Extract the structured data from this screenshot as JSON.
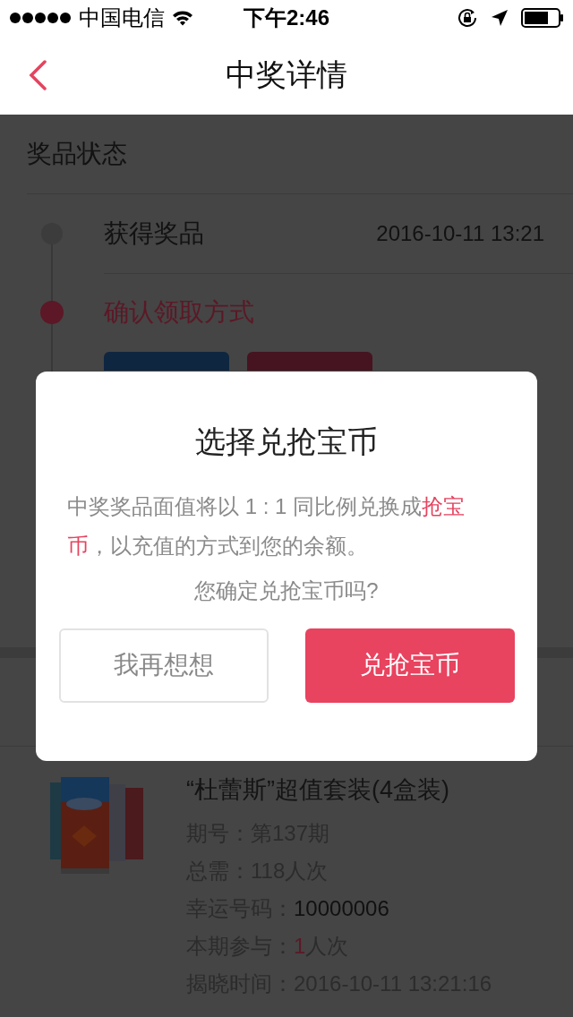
{
  "status_bar": {
    "carrier": "中国电信",
    "time": "下午2:46"
  },
  "nav": {
    "title": "中奖详情"
  },
  "prize_status": {
    "title": "奖品状态",
    "steps": [
      {
        "label": "获得奖品",
        "time": "2016-10-11 13:21",
        "active": false
      },
      {
        "label": "确认领取方式",
        "active": true
      }
    ],
    "claim_buttons": [
      {
        "color": "#0e2640"
      },
      {
        "color": "#461420"
      }
    ]
  },
  "product": {
    "title": "“杜蕾斯”超值套装(4盒装)",
    "lines": [
      {
        "label": "期号：",
        "parts": [
          {
            "text": "第137期",
            "kind": "normal"
          }
        ]
      },
      {
        "label": "总需：",
        "parts": [
          {
            "text": "118人次",
            "kind": "normal"
          }
        ]
      },
      {
        "label": "幸运号码：",
        "parts": [
          {
            "text": "10000006",
            "kind": "strong"
          }
        ]
      },
      {
        "label": "本期参与：",
        "parts": [
          {
            "text": "1",
            "kind": "accent"
          },
          {
            "text": "人次",
            "kind": "normal"
          }
        ]
      },
      {
        "label": "揭晓时间：",
        "parts": [
          {
            "text": "2016-10-11 13:21:16",
            "kind": "normal"
          }
        ]
      }
    ]
  },
  "dialog": {
    "title": "选择兑抢宝币",
    "message": [
      {
        "text": "中奖奖品面值将以 1 : 1 同比例兑换成",
        "highlight": false
      },
      {
        "text": "抢宝币",
        "highlight": true
      },
      {
        "text": "，以充值的方式到您的余额。",
        "highlight": false
      }
    ],
    "question": "您确定兑抢宝币吗?",
    "buttons": [
      {
        "label": "我再想想",
        "kind": "secondary"
      },
      {
        "label": "兑抢宝币",
        "kind": "primary"
      }
    ]
  }
}
